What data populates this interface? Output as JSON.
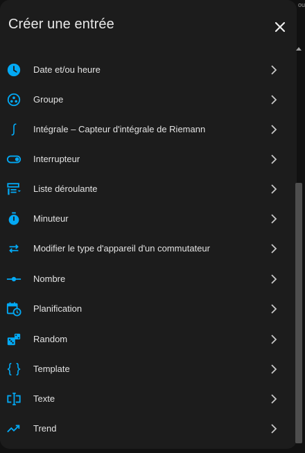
{
  "dialog": {
    "title": "Créer une entrée",
    "close_icon": "close-icon",
    "corner_text": "ou"
  },
  "colors": {
    "accent": "#03a9f4",
    "background": "#1c1c1c",
    "text": "#e3e3e3"
  },
  "items": [
    {
      "label": "Date et/ou heure",
      "icon": "clock-icon"
    },
    {
      "label": "Groupe",
      "icon": "group-icon"
    },
    {
      "label": "Intégrale – Capteur d'intégrale de Riemann",
      "icon": "integral-icon"
    },
    {
      "label": "Interrupteur",
      "icon": "toggle-switch-icon"
    },
    {
      "label": "Liste déroulante",
      "icon": "form-dropdown-icon"
    },
    {
      "label": "Minuteur",
      "icon": "timer-icon"
    },
    {
      "label": "Modifier le type d'appareil d'un commutateur",
      "icon": "swap-horizontal-icon"
    },
    {
      "label": "Nombre",
      "icon": "ray-vertex-icon"
    },
    {
      "label": "Planification",
      "icon": "calendar-clock-icon"
    },
    {
      "label": "Random",
      "icon": "dice-icon"
    },
    {
      "label": "Template",
      "icon": "code-braces-icon"
    },
    {
      "label": "Texte",
      "icon": "form-textbox-icon"
    },
    {
      "label": "Trend",
      "icon": "trending-up-icon"
    }
  ]
}
